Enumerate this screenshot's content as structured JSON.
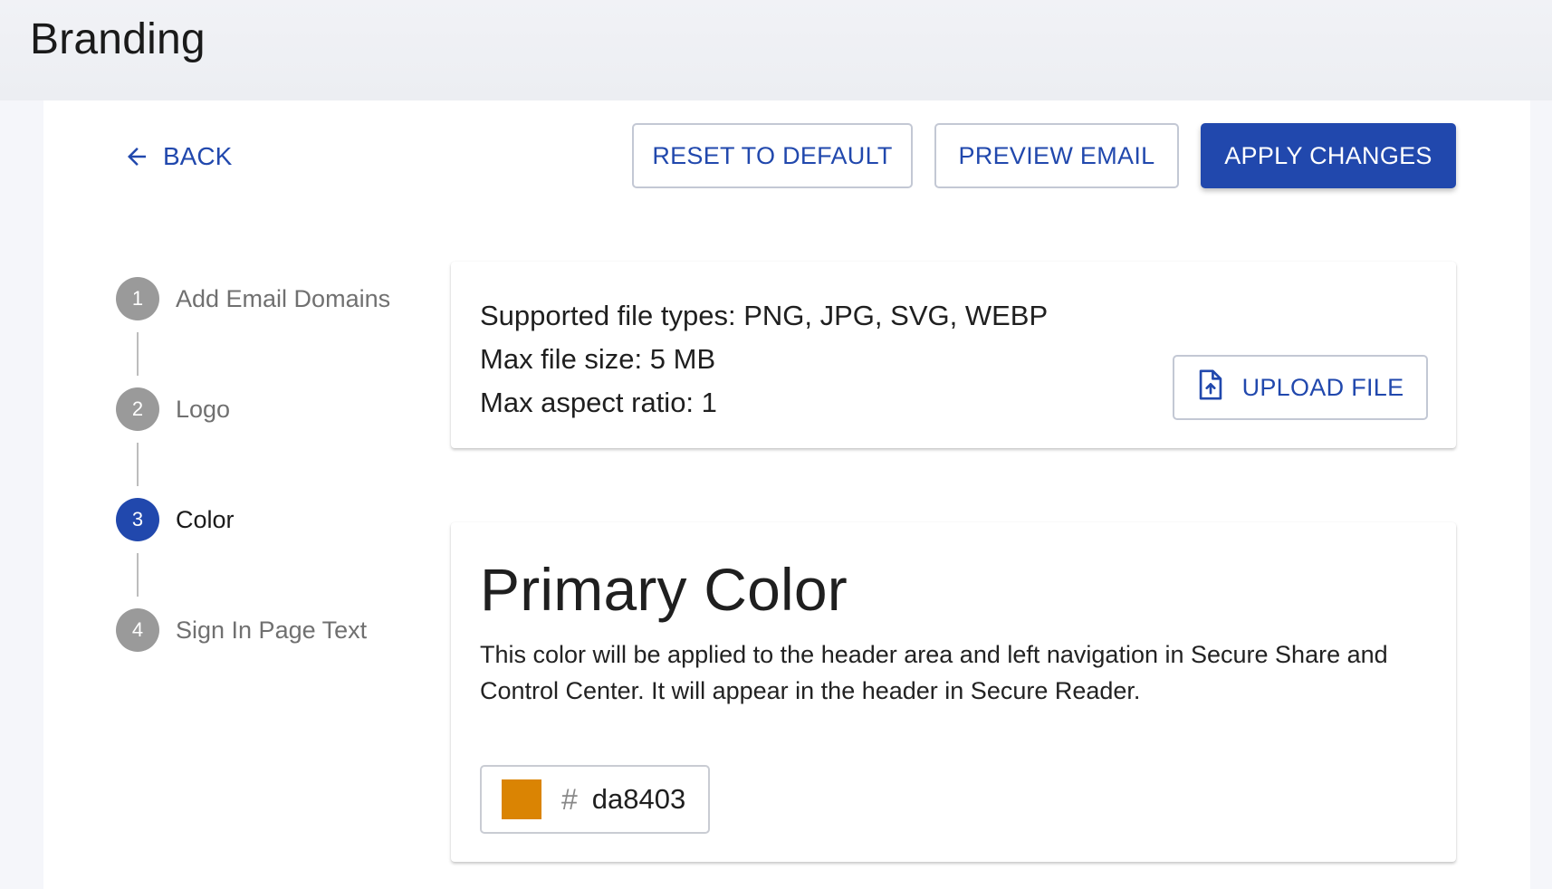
{
  "header": {
    "title": "Branding"
  },
  "toolbar": {
    "back_label": "BACK",
    "reset_label": "RESET TO DEFAULT",
    "preview_label": "PREVIEW EMAIL",
    "apply_label": "APPLY CHANGES"
  },
  "stepper": {
    "steps": [
      {
        "number": "1",
        "label": "Add Email Domains",
        "state": "inactive"
      },
      {
        "number": "2",
        "label": "Logo",
        "state": "inactive"
      },
      {
        "number": "3",
        "label": "Color",
        "state": "active"
      },
      {
        "number": "4",
        "label": "Sign In Page Text",
        "state": "inactive"
      }
    ]
  },
  "logo_card": {
    "file_types": "Supported file types: PNG, JPG, SVG, WEBP",
    "max_size": "Max file size: 5 MB",
    "max_ratio": "Max aspect ratio: 1",
    "upload_label": "UPLOAD FILE",
    "upload_icon": "file-upload-icon"
  },
  "color_card": {
    "title": "Primary Color",
    "description": "This color will be applied to the header area and left navigation in Secure Share and Control Center. It will appear in the header in Secure Reader.",
    "hash_symbol": "#",
    "hex_value": "da8403"
  },
  "colors": {
    "accent": "#2148ad",
    "swatch": "#da8403",
    "step_inactive": "#9a9a9a"
  }
}
